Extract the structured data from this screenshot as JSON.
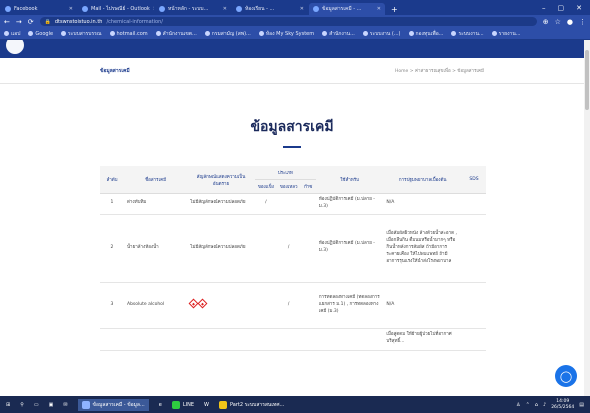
{
  "browser": {
    "tabs": [
      {
        "label": "Facebook"
      },
      {
        "label": "Mail - ไปรษณีย์ - Outlook"
      },
      {
        "label": "หน้าหลัก - ระบบ..."
      },
      {
        "label": "ห้องเรียน - ..."
      },
      {
        "label": "ข้อมูลสารเคมี - ..."
      }
    ],
    "newtab": "+",
    "winctl": [
      "–",
      "▢",
      "✕"
    ],
    "url_host": "dtswnstoistuo.in.th",
    "url_path": "/chemical-information/",
    "bookmarks": [
      "แอป",
      "Google",
      "ระบบสารบรรณ",
      "hotmail.com",
      "สำนักงานเขต...",
      "กรมสามัญ (สพ)...",
      "ห้อง My Sky System",
      "สำนักงาน...",
      "ระบบงาน (...)",
      "กองทุนเพื่อ...",
      "ระบบงาน...",
      "รายงาน..."
    ]
  },
  "page": {
    "page_title": "ข้อมูลสารเคมี",
    "breadcrumb": "Home > ค่าสาธารณสุขเพื่อ > ข้อมูลสารเคมี",
    "headline": "ข้อมูลสารเคมี"
  },
  "table": {
    "headers": {
      "no": "ลำดับ",
      "name": "ชื่อสารเคมี",
      "ghs": "สัญลักษณ์แสดงความเป็นอันตราย",
      "state": "ประเภท",
      "state_solid": "ของแข็ง",
      "state_liquid": "ของเหลว",
      "state_gas": "ก๊าซ",
      "use": "ใช้สำหรับ",
      "firstaid": "การปฐมพยาบาลเบื้องต้น",
      "sds": "SDS"
    },
    "rows": [
      {
        "no": "1",
        "name": "ด่างทับทิม",
        "ghs": "ไม่มีสัญลักษณ์ความปลอดภัย",
        "solid": "/",
        "liquid": "",
        "gas": "",
        "use": "ห้องปฏิบัติการเคมี (ม.ปลาย - ม.3)",
        "firstaid": "N/A"
      },
      {
        "no": "2",
        "name": "น้ำยาล้างห้องน้ำ",
        "ghs": "ไม่มีสัญลักษณ์ความปลอดภัย",
        "solid": "",
        "liquid": "/",
        "gas": "",
        "use": "ห้องปฏิบัติการเคมี (ม.ปลาย - ม.3)",
        "firstaid": "เมื่อสัมผัสผิวหนัง ล้างด้วยน้ำสะอาด , เมื่อกลืนกิน ดื่มนมหรือน้ำมากๆ หรือกินน้ำหลังการสัมผัส ถ้ามีอาการระคายเคือง ให้ไปพบแพทย์ ถ้ามีอาการรุนแรงให้นำส่งโรงพยาบาล"
      },
      {
        "no": "3",
        "name": "Absolute alcohol",
        "ghs": "",
        "solid": "",
        "liquid": "/",
        "gas": "",
        "use": "การทดลองทางเคมี (ทดลองการแยกสาร ม.1) , การทดลองทางเคมี (ม.3)",
        "firstaid": "N/A"
      },
      {
        "no": "",
        "name": "",
        "ghs": "",
        "solid": "",
        "liquid": "",
        "gas": "",
        "use": "",
        "firstaid": "เมื่อสูดดม ให้ย้ายผู้ป่วยไปที่อากาศบริสุทธิ์..."
      }
    ]
  },
  "taskbar": {
    "items": [
      "ข้อมูลสารเคมี - ข้อมูล...",
      "LINE",
      "Part2 ระบบสารสนเทศ..."
    ],
    "time": "14:09",
    "date": "26/5/2564"
  },
  "colors": {
    "brand": "#1b3a8c",
    "chat": "#1a73e8",
    "hazard": "#dd2222"
  }
}
